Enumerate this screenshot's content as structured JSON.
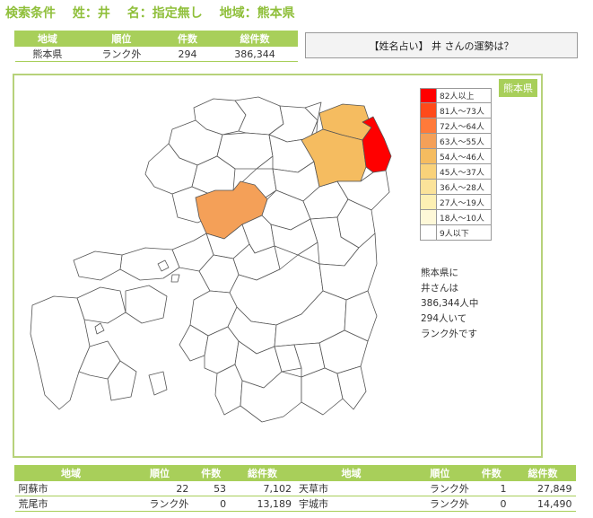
{
  "search": {
    "label": "検索条件",
    "surname": "姓：井",
    "given": "名：指定無し",
    "region": "地域：熊本県"
  },
  "summary": {
    "headers": [
      "地域",
      "順位",
      "件数",
      "総件数"
    ],
    "row": [
      "熊本県",
      "ランク外",
      "294",
      "386,344"
    ]
  },
  "fortune_button": "【姓名占い】 井 さんの運勢は？",
  "map": {
    "prefecture_badge": "熊本県",
    "legend": [
      {
        "label": "82人以上",
        "color": "#ff0000"
      },
      {
        "label": "81人〜73人",
        "color": "#ff4a1a"
      },
      {
        "label": "72人〜64人",
        "color": "#ff7a3a"
      },
      {
        "label": "63人〜55人",
        "color": "#f4a058"
      },
      {
        "label": "54人〜46人",
        "color": "#f5bc60"
      },
      {
        "label": "45人〜37人",
        "color": "#f9d27a"
      },
      {
        "label": "36人〜28人",
        "color": "#fbe39a"
      },
      {
        "label": "27人〜19人",
        "color": "#fdf0b4"
      },
      {
        "label": "18人〜10人",
        "color": "#fef8d8"
      },
      {
        "label": "9人以下",
        "color": "#ffffff"
      }
    ],
    "info_lines": [
      "熊本県に",
      "井さんは",
      "386,344人中",
      "294人いて",
      "ランク外です"
    ]
  },
  "cities": {
    "headers": [
      "地域",
      "順位",
      "件数",
      "総件数",
      "地域",
      "順位",
      "件数",
      "総件数"
    ],
    "rows": [
      [
        "阿蘇市",
        "22",
        "53",
        "7,102",
        "天草市",
        "ランク外",
        "1",
        "27,849"
      ],
      [
        "荒尾市",
        "ランク外",
        "0",
        "13,189",
        "宇城市",
        "ランク外",
        "0",
        "14,490"
      ]
    ]
  }
}
